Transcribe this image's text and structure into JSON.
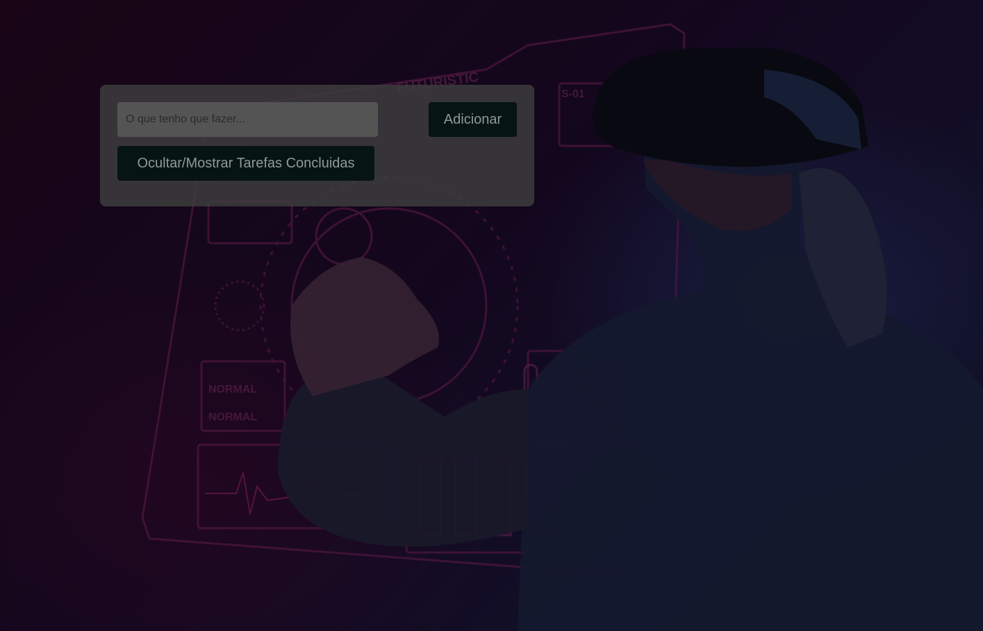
{
  "background": {
    "image": "vr-headset-futuristic-interface",
    "hud_text": [
      "FUTURISTIC",
      "S-01",
      "NORMAL",
      "NORMAL"
    ]
  },
  "todo": {
    "input_placeholder": "O que tenho que fazer...",
    "input_value": "",
    "add_label": "Adicionar",
    "toggle_label": "Ocultar/Mostrar Tarefas Concluidas"
  },
  "colors": {
    "panel": "#3e3e3e",
    "button_bg": "#061412",
    "button_text": "#8e9a97"
  }
}
